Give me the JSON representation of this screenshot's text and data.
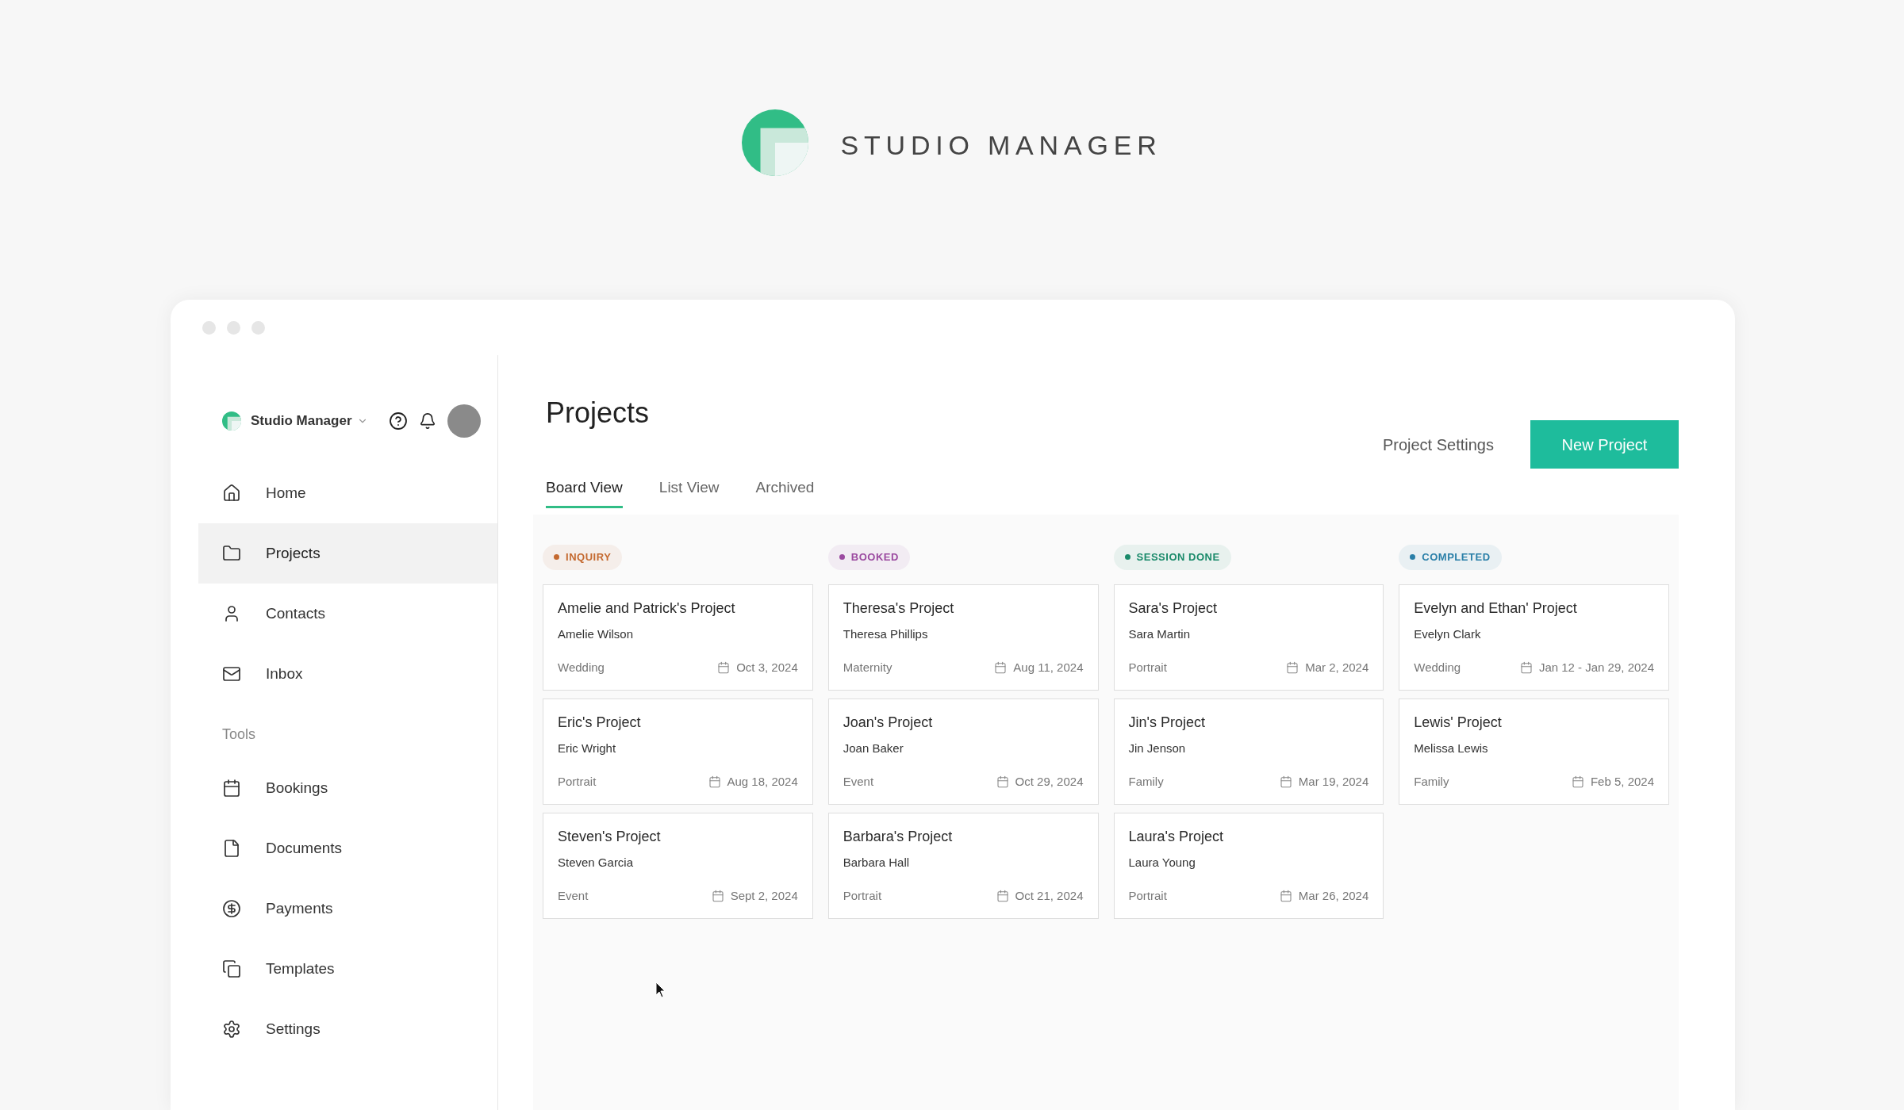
{
  "brand": {
    "title": "STUDIO MANAGER"
  },
  "sidebar": {
    "workspace": "Studio Manager",
    "nav": [
      {
        "label": "Home",
        "selected": false
      },
      {
        "label": "Projects",
        "selected": true
      },
      {
        "label": "Contacts",
        "selected": false
      },
      {
        "label": "Inbox",
        "selected": false
      }
    ],
    "tools_label": "Tools",
    "tools": [
      {
        "label": "Bookings",
        "selected": false
      },
      {
        "label": "Documents",
        "selected": false
      },
      {
        "label": "Payments",
        "selected": false
      },
      {
        "label": "Templates",
        "selected": false
      },
      {
        "label": "Settings",
        "selected": false
      }
    ]
  },
  "page": {
    "title": "Projects",
    "secondary_button": "Project Settings",
    "primary_button": "New Project"
  },
  "tabs": [
    {
      "label": "Board View",
      "selected": true
    },
    {
      "label": "List View",
      "selected": false
    },
    {
      "label": "Archived",
      "selected": false
    }
  ],
  "columns": [
    {
      "status": "INQUIRY",
      "color": "#c4692f",
      "cards": [
        {
          "title": "Amelie and Patrick's Project",
          "client": "Amelie Wilson",
          "type": "Wedding",
          "date": "Oct 3, 2024"
        },
        {
          "title": "Eric's Project",
          "client": "Eric Wright",
          "type": "Portrait",
          "date": "Aug 18, 2024"
        },
        {
          "title": "Steven's Project",
          "client": "Steven Garcia",
          "type": "Event",
          "date": "Sept 2, 2024"
        }
      ]
    },
    {
      "status": "BOOKED",
      "color": "#9b4aa0",
      "cards": [
        {
          "title": "Theresa's Project",
          "client": "Theresa Phillips",
          "type": "Maternity",
          "date": "Aug 11, 2024"
        },
        {
          "title": "Joan's Project",
          "client": "Joan Baker",
          "type": "Event",
          "date": "Oct 29, 2024"
        },
        {
          "title": "Barbara's Project",
          "client": "Barbara Hall",
          "type": "Portrait",
          "date": "Oct 21, 2024"
        }
      ]
    },
    {
      "status": "SESSION DONE",
      "color": "#1a8a6a",
      "cards": [
        {
          "title": "Sara's Project",
          "client": "Sara Martin",
          "type": "Portrait",
          "date": "Mar 2, 2024"
        },
        {
          "title": "Jin's Project",
          "client": "Jin Jenson",
          "type": "Family",
          "date": "Mar 19, 2024"
        },
        {
          "title": "Laura's Project",
          "client": "Laura Young",
          "type": "Portrait",
          "date": "Mar 26, 2024"
        }
      ]
    },
    {
      "status": "COMPLETED",
      "color": "#2a7fa8",
      "cards": [
        {
          "title": "Evelyn and Ethan' Project",
          "client": "Evelyn Clark",
          "type": "Wedding",
          "date": "Jan 12 - Jan 29, 2024"
        },
        {
          "title": "Lewis' Project",
          "client": "Melissa Lewis",
          "type": "Family",
          "date": "Feb 5, 2024"
        }
      ]
    }
  ]
}
